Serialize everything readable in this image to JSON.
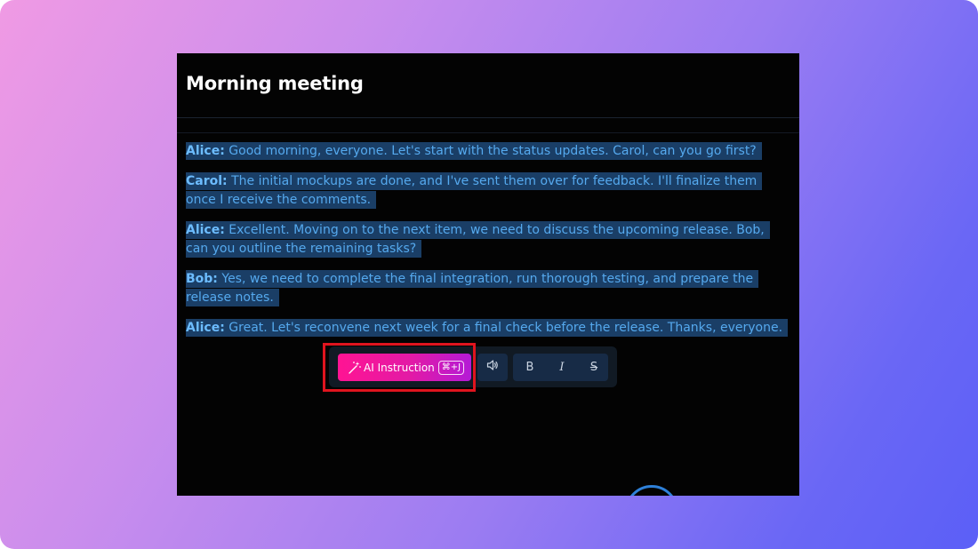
{
  "document": {
    "title": "Morning meeting"
  },
  "transcript": [
    {
      "speaker": "Alice:",
      "text": " Good morning, everyone. Let's start with the status updates. Carol, can you go first?"
    },
    {
      "speaker": "Carol:",
      "text": " The initial mockups are done, and I've sent them over for feedback. I'll finalize them once I receive the comments."
    },
    {
      "speaker": "Alice:",
      "text": " Excellent. Moving on to the next item, we need to discuss the upcoming release. Bob, can you outline the remaining tasks?"
    },
    {
      "speaker": "Bob:",
      "text": " Yes, we need to complete the final integration, run thorough testing, and prepare the release notes."
    },
    {
      "speaker": "Alice:",
      "text": " Great. Let's reconvene next week for a final check before the release. Thanks, everyone."
    }
  ],
  "toolbar": {
    "ai_label": "AI Instruction",
    "ai_shortcut": "⌘+J",
    "bold_label": "B",
    "italic_label": "I",
    "strike_label": "S"
  },
  "colors": {
    "ai_gradient_start": "#ff1493",
    "ai_gradient_end": "#b41ad6",
    "selection": "#1a3e66",
    "highlight_box": "#e0141e"
  },
  "icons": {
    "ai": "magic-wand-icon",
    "audio": "speaker-icon"
  }
}
